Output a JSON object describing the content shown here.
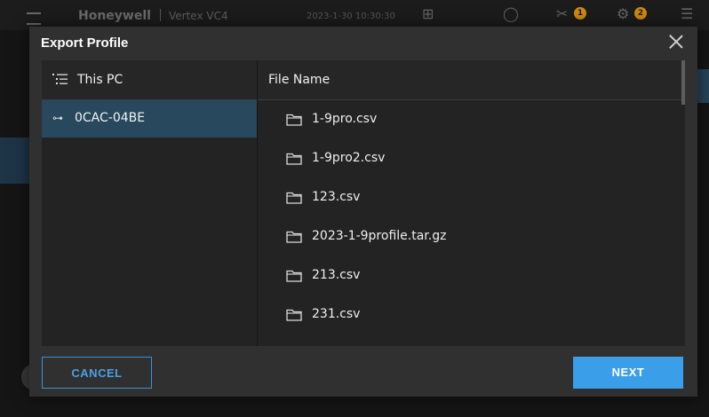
{
  "background": {
    "brand": "Honeywell",
    "product": "Vertex VC4",
    "datetime": "2023-1-30 10:30:30",
    "badges": [
      "1",
      "2"
    ]
  },
  "dialog": {
    "title": "Export Profile",
    "left_header": "This PC",
    "drive_label": "0CAC-04BE",
    "right_header": "File Name",
    "files": [
      "1-9pro.csv",
      "1-9pro2.csv",
      "123.csv",
      "2023-1-9profile.tar.gz",
      "213.csv",
      "231.csv"
    ],
    "cancel_label": "CANCEL",
    "next_label": "NEXT"
  },
  "colors": {
    "accent": "#3b9ee8",
    "selected_row": "#28485e",
    "modal_bg": "#303030",
    "pane_bg": "#232323"
  }
}
